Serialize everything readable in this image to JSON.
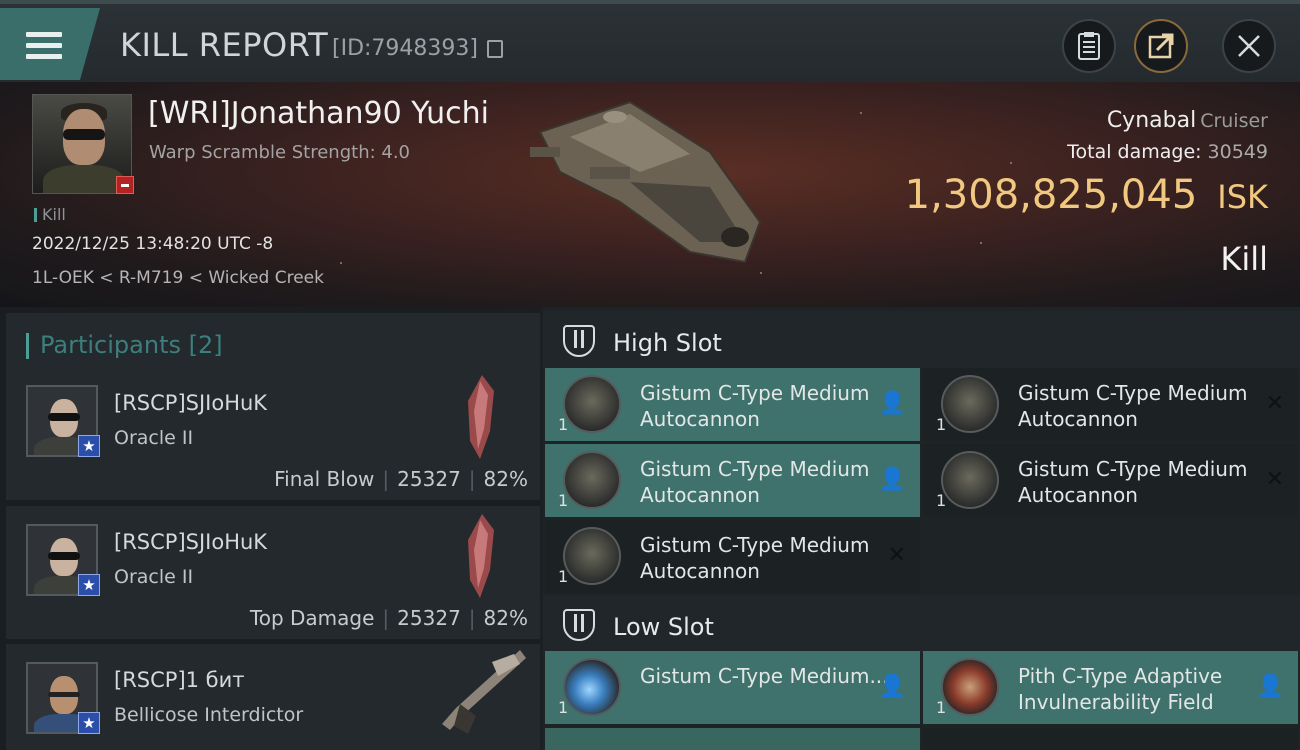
{
  "header": {
    "title": "KILL REPORT",
    "report_id": "[ID:7948393]",
    "menu_icon": "hamburger-icon",
    "buttons": [
      "clipboard-icon",
      "share-icon",
      "close-icon"
    ]
  },
  "victim": {
    "name": "[WRI]Jonathan90 Yuchi",
    "subtitle": "Warp Scramble Strength: 4.0",
    "kill_tag": "Kill",
    "timestamp": "2022/12/25 13:48:20 UTC -8",
    "location": "1L-OEK < R-M719 < Wicked Creek",
    "ship": "Cynabal",
    "ship_class": "Cruiser",
    "total_damage_label": "Total damage:",
    "total_damage": "30549",
    "isk_value": "1,308,825,045",
    "isk_unit": "ISK",
    "result": "Kill"
  },
  "participants": {
    "title": "Participants",
    "count": "[2]",
    "rows": [
      {
        "name": "[RSCP]SJIoHuK",
        "ship": "Oracle II",
        "role": "Final Blow",
        "damage": "25327",
        "percent": "82%"
      },
      {
        "name": "[RSCP]SJIoHuK",
        "ship": "Oracle II",
        "role": "Top Damage",
        "damage": "25327",
        "percent": "82%"
      },
      {
        "name": "[RSCP]1 бит",
        "ship": "Bellicose Interdictor",
        "role": "",
        "damage": "",
        "percent": ""
      }
    ]
  },
  "slots": {
    "high": {
      "label": "High Slot",
      "modules": [
        {
          "name": "Gistum C-Type Medium Autocannon",
          "qty": "1",
          "status": "fitted"
        },
        {
          "name": "Gistum C-Type Medium Autocannon",
          "qty": "1",
          "status": "destroyed"
        },
        {
          "name": "Gistum C-Type Medium Autocannon",
          "qty": "1",
          "status": "fitted"
        },
        {
          "name": "Gistum C-Type Medium Autocannon",
          "qty": "1",
          "status": "destroyed"
        },
        {
          "name": "Gistum C-Type Medium Autocannon",
          "qty": "1",
          "status": "destroyed"
        }
      ]
    },
    "low": {
      "label": "Low Slot",
      "modules": [
        {
          "name": "Gistum C-Type Medium...",
          "qty": "1",
          "status": "fitted"
        },
        {
          "name": "Pith C-Type Adaptive Invulnerability Field",
          "qty": "1",
          "status": "fitted"
        }
      ]
    }
  }
}
